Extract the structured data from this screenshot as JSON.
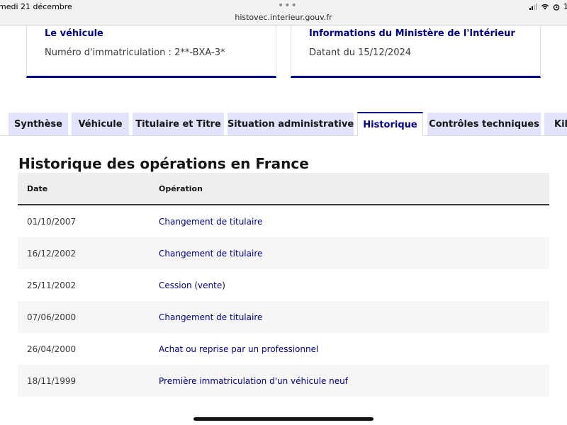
{
  "status_bar": {
    "date": "medi 21 décembre",
    "battery_partial": "1"
  },
  "browser": {
    "url": "histovec.interieur.gouv.fr",
    "menu_dots": "•••"
  },
  "cards": {
    "vehicle": {
      "title": "Le véhicule",
      "text": "Numéro d'immatriculation : 2**-BXA-3*"
    },
    "ministry": {
      "title": "Informations du Ministère de l'Intérieur",
      "text": "Datant du 15/12/2024"
    }
  },
  "tabs": [
    {
      "label": "Synthèse",
      "active": false
    },
    {
      "label": "Véhicule",
      "active": false
    },
    {
      "label": "Titulaire et Titre",
      "active": false
    },
    {
      "label": "Situation administrative",
      "active": false
    },
    {
      "label": "Historique",
      "active": true
    },
    {
      "label": "Contrôles techniques",
      "active": false
    },
    {
      "label": "Kilo",
      "active": false
    }
  ],
  "history": {
    "title": "Historique des opérations en France",
    "columns": {
      "date": "Date",
      "operation": "Opération"
    },
    "rows": [
      {
        "date": "01/10/2007",
        "operation": "Changement de titulaire"
      },
      {
        "date": "16/12/2002",
        "operation": "Changement de titulaire"
      },
      {
        "date": "25/11/2002",
        "operation": "Cession (vente)"
      },
      {
        "date": "07/06/2000",
        "operation": "Changement de titulaire"
      },
      {
        "date": "26/04/2000",
        "operation": "Achat ou reprise par un professionnel"
      },
      {
        "date": "18/11/1999",
        "operation": "Première immatriculation d'un véhicule neuf"
      }
    ]
  },
  "colors": {
    "accent": "#000091",
    "tab_inactive_bg": "#e3e3fd",
    "row_alt_bg": "#f6f6f6",
    "header_bg": "#eeeeee"
  }
}
